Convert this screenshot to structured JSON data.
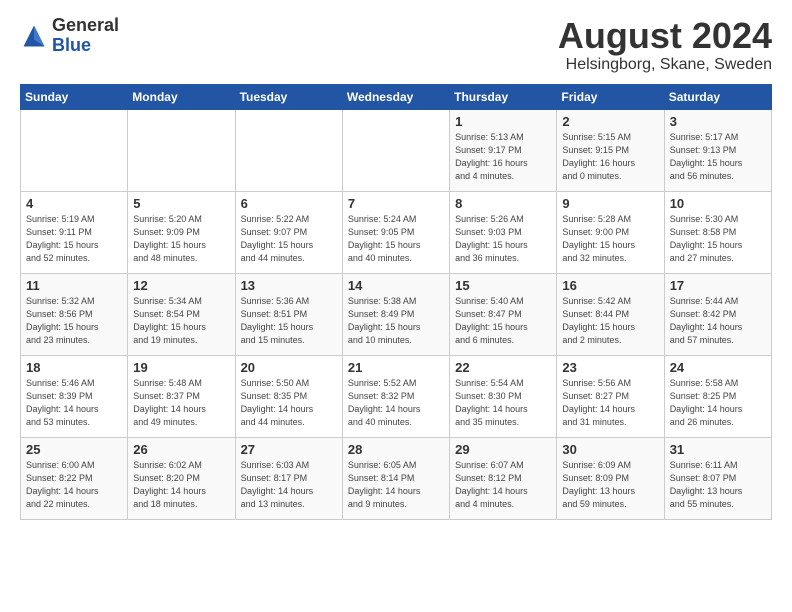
{
  "header": {
    "logo_general": "General",
    "logo_blue": "Blue",
    "month_year": "August 2024",
    "location": "Helsingborg, Skane, Sweden"
  },
  "weekdays": [
    "Sunday",
    "Monday",
    "Tuesday",
    "Wednesday",
    "Thursday",
    "Friday",
    "Saturday"
  ],
  "weeks": [
    [
      {
        "day": "",
        "info": ""
      },
      {
        "day": "",
        "info": ""
      },
      {
        "day": "",
        "info": ""
      },
      {
        "day": "",
        "info": ""
      },
      {
        "day": "1",
        "info": "Sunrise: 5:13 AM\nSunset: 9:17 PM\nDaylight: 16 hours\nand 4 minutes."
      },
      {
        "day": "2",
        "info": "Sunrise: 5:15 AM\nSunset: 9:15 PM\nDaylight: 16 hours\nand 0 minutes."
      },
      {
        "day": "3",
        "info": "Sunrise: 5:17 AM\nSunset: 9:13 PM\nDaylight: 15 hours\nand 56 minutes."
      }
    ],
    [
      {
        "day": "4",
        "info": "Sunrise: 5:19 AM\nSunset: 9:11 PM\nDaylight: 15 hours\nand 52 minutes."
      },
      {
        "day": "5",
        "info": "Sunrise: 5:20 AM\nSunset: 9:09 PM\nDaylight: 15 hours\nand 48 minutes."
      },
      {
        "day": "6",
        "info": "Sunrise: 5:22 AM\nSunset: 9:07 PM\nDaylight: 15 hours\nand 44 minutes."
      },
      {
        "day": "7",
        "info": "Sunrise: 5:24 AM\nSunset: 9:05 PM\nDaylight: 15 hours\nand 40 minutes."
      },
      {
        "day": "8",
        "info": "Sunrise: 5:26 AM\nSunset: 9:03 PM\nDaylight: 15 hours\nand 36 minutes."
      },
      {
        "day": "9",
        "info": "Sunrise: 5:28 AM\nSunset: 9:00 PM\nDaylight: 15 hours\nand 32 minutes."
      },
      {
        "day": "10",
        "info": "Sunrise: 5:30 AM\nSunset: 8:58 PM\nDaylight: 15 hours\nand 27 minutes."
      }
    ],
    [
      {
        "day": "11",
        "info": "Sunrise: 5:32 AM\nSunset: 8:56 PM\nDaylight: 15 hours\nand 23 minutes."
      },
      {
        "day": "12",
        "info": "Sunrise: 5:34 AM\nSunset: 8:54 PM\nDaylight: 15 hours\nand 19 minutes."
      },
      {
        "day": "13",
        "info": "Sunrise: 5:36 AM\nSunset: 8:51 PM\nDaylight: 15 hours\nand 15 minutes."
      },
      {
        "day": "14",
        "info": "Sunrise: 5:38 AM\nSunset: 8:49 PM\nDaylight: 15 hours\nand 10 minutes."
      },
      {
        "day": "15",
        "info": "Sunrise: 5:40 AM\nSunset: 8:47 PM\nDaylight: 15 hours\nand 6 minutes."
      },
      {
        "day": "16",
        "info": "Sunrise: 5:42 AM\nSunset: 8:44 PM\nDaylight: 15 hours\nand 2 minutes."
      },
      {
        "day": "17",
        "info": "Sunrise: 5:44 AM\nSunset: 8:42 PM\nDaylight: 14 hours\nand 57 minutes."
      }
    ],
    [
      {
        "day": "18",
        "info": "Sunrise: 5:46 AM\nSunset: 8:39 PM\nDaylight: 14 hours\nand 53 minutes."
      },
      {
        "day": "19",
        "info": "Sunrise: 5:48 AM\nSunset: 8:37 PM\nDaylight: 14 hours\nand 49 minutes."
      },
      {
        "day": "20",
        "info": "Sunrise: 5:50 AM\nSunset: 8:35 PM\nDaylight: 14 hours\nand 44 minutes."
      },
      {
        "day": "21",
        "info": "Sunrise: 5:52 AM\nSunset: 8:32 PM\nDaylight: 14 hours\nand 40 minutes."
      },
      {
        "day": "22",
        "info": "Sunrise: 5:54 AM\nSunset: 8:30 PM\nDaylight: 14 hours\nand 35 minutes."
      },
      {
        "day": "23",
        "info": "Sunrise: 5:56 AM\nSunset: 8:27 PM\nDaylight: 14 hours\nand 31 minutes."
      },
      {
        "day": "24",
        "info": "Sunrise: 5:58 AM\nSunset: 8:25 PM\nDaylight: 14 hours\nand 26 minutes."
      }
    ],
    [
      {
        "day": "25",
        "info": "Sunrise: 6:00 AM\nSunset: 8:22 PM\nDaylight: 14 hours\nand 22 minutes."
      },
      {
        "day": "26",
        "info": "Sunrise: 6:02 AM\nSunset: 8:20 PM\nDaylight: 14 hours\nand 18 minutes."
      },
      {
        "day": "27",
        "info": "Sunrise: 6:03 AM\nSunset: 8:17 PM\nDaylight: 14 hours\nand 13 minutes."
      },
      {
        "day": "28",
        "info": "Sunrise: 6:05 AM\nSunset: 8:14 PM\nDaylight: 14 hours\nand 9 minutes."
      },
      {
        "day": "29",
        "info": "Sunrise: 6:07 AM\nSunset: 8:12 PM\nDaylight: 14 hours\nand 4 minutes."
      },
      {
        "day": "30",
        "info": "Sunrise: 6:09 AM\nSunset: 8:09 PM\nDaylight: 13 hours\nand 59 minutes."
      },
      {
        "day": "31",
        "info": "Sunrise: 6:11 AM\nSunset: 8:07 PM\nDaylight: 13 hours\nand 55 minutes."
      }
    ]
  ]
}
